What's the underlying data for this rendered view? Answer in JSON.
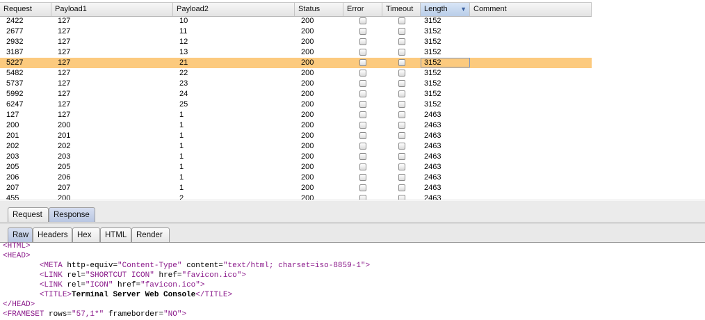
{
  "table": {
    "columns": [
      "Request",
      "Payload1",
      "Payload2",
      "Status",
      "Error",
      "Timeout",
      "Length",
      "Comment"
    ],
    "sorted_column": "Length",
    "rows": [
      {
        "request": "2422",
        "payload1": "127",
        "payload2": "10",
        "status": "200",
        "length": "3152"
      },
      {
        "request": "2677",
        "payload1": "127",
        "payload2": "11",
        "status": "200",
        "length": "3152"
      },
      {
        "request": "2932",
        "payload1": "127",
        "payload2": "12",
        "status": "200",
        "length": "3152"
      },
      {
        "request": "3187",
        "payload1": "127",
        "payload2": "13",
        "status": "200",
        "length": "3152"
      },
      {
        "request": "5227",
        "payload1": "127",
        "payload2": "21",
        "status": "200",
        "length": "3152",
        "selected": true
      },
      {
        "request": "5482",
        "payload1": "127",
        "payload2": "22",
        "status": "200",
        "length": "3152"
      },
      {
        "request": "5737",
        "payload1": "127",
        "payload2": "23",
        "status": "200",
        "length": "3152"
      },
      {
        "request": "5992",
        "payload1": "127",
        "payload2": "24",
        "status": "200",
        "length": "3152"
      },
      {
        "request": "6247",
        "payload1": "127",
        "payload2": "25",
        "status": "200",
        "length": "3152"
      },
      {
        "request": "127",
        "payload1": "127",
        "payload2": "1",
        "status": "200",
        "length": "2463"
      },
      {
        "request": "200",
        "payload1": "200",
        "payload2": "1",
        "status": "200",
        "length": "2463"
      },
      {
        "request": "201",
        "payload1": "201",
        "payload2": "1",
        "status": "200",
        "length": "2463"
      },
      {
        "request": "202",
        "payload1": "202",
        "payload2": "1",
        "status": "200",
        "length": "2463"
      },
      {
        "request": "203",
        "payload1": "203",
        "payload2": "1",
        "status": "200",
        "length": "2463"
      },
      {
        "request": "205",
        "payload1": "205",
        "payload2": "1",
        "status": "200",
        "length": "2463"
      },
      {
        "request": "206",
        "payload1": "206",
        "payload2": "1",
        "status": "200",
        "length": "2463"
      },
      {
        "request": "207",
        "payload1": "207",
        "payload2": "1",
        "status": "200",
        "length": "2463"
      },
      {
        "request": "455",
        "payload1": "200",
        "payload2": "2",
        "status": "200",
        "length": "2463"
      }
    ]
  },
  "outer_tabs": [
    "Request",
    "Response"
  ],
  "outer_active": "Response",
  "inner_tabs": [
    "Raw",
    "Headers",
    "Hex",
    "HTML",
    "Render"
  ],
  "inner_active": "Raw",
  "code_lines": [
    [
      {
        "t": "<HTML>",
        "c": "tag"
      }
    ],
    [
      {
        "t": "<HEAD>",
        "c": "tag"
      }
    ],
    [
      {
        "t": "        "
      },
      {
        "t": "<META",
        "c": "tag"
      },
      {
        "t": " http-equiv=",
        "c": "attr"
      },
      {
        "t": "\"Content-Type\"",
        "c": "val"
      },
      {
        "t": " content=",
        "c": "attr"
      },
      {
        "t": "\"text/html; charset=iso-8859-1\"",
        "c": "val"
      },
      {
        "t": ">",
        "c": "tag"
      }
    ],
    [
      {
        "t": "        "
      },
      {
        "t": "<LINK",
        "c": "tag"
      },
      {
        "t": " rel=",
        "c": "attr"
      },
      {
        "t": "\"SHORTCUT ICON\"",
        "c": "val"
      },
      {
        "t": " href=",
        "c": "attr"
      },
      {
        "t": "\"favicon.ico\"",
        "c": "val"
      },
      {
        "t": ">",
        "c": "tag"
      }
    ],
    [
      {
        "t": "        "
      },
      {
        "t": "<LINK",
        "c": "tag"
      },
      {
        "t": " rel=",
        "c": "attr"
      },
      {
        "t": "\"ICON\"",
        "c": "val"
      },
      {
        "t": " href=",
        "c": "attr"
      },
      {
        "t": "\"favicon.ico\"",
        "c": "val"
      },
      {
        "t": ">",
        "c": "tag"
      }
    ],
    [
      {
        "t": "        "
      },
      {
        "t": "<TITLE>",
        "c": "tag"
      },
      {
        "t": "Terminal Server Web Console",
        "c": "bold"
      },
      {
        "t": "</TITLE>",
        "c": "tag"
      }
    ],
    [
      {
        "t": "</HEAD>",
        "c": "tag"
      }
    ],
    [
      {
        "t": "<FRAMESET",
        "c": "tag"
      },
      {
        "t": " rows=",
        "c": "attr"
      },
      {
        "t": "\"57,1*\"",
        "c": "val"
      },
      {
        "t": " frameborder=",
        "c": "attr"
      },
      {
        "t": "\"NO\"",
        "c": "val"
      },
      {
        "t": ">",
        "c": "tag"
      }
    ]
  ]
}
